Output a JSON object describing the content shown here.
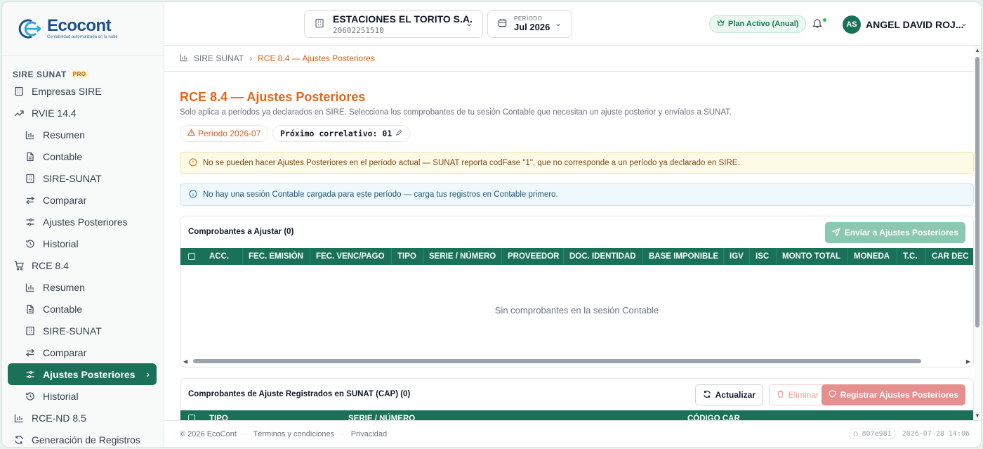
{
  "brand": {
    "name": "Ecocont",
    "tagline": "Contabilidad automatizada en la nube"
  },
  "sidebar": {
    "section_title": "SIRE SUNAT",
    "section_badge": "PRO",
    "items": [
      {
        "label": "Empresas SIRE",
        "icon": "building-icon"
      },
      {
        "label": "RVIE 14.4",
        "icon": "trending-up-icon"
      },
      {
        "label": "Resumen",
        "icon": "bar-chart-icon"
      },
      {
        "label": "Contable",
        "icon": "document-icon"
      },
      {
        "label": "SIRE-SUNAT",
        "icon": "building-icon"
      },
      {
        "label": "Comparar",
        "icon": "arrows-exchange-icon"
      },
      {
        "label": "Ajustes Posteriores",
        "icon": "sliders-icon"
      },
      {
        "label": "Historial",
        "icon": "history-icon"
      },
      {
        "label": "RCE 8.4",
        "icon": "cart-icon"
      },
      {
        "label": "Resumen",
        "icon": "bar-chart-icon"
      },
      {
        "label": "Contable",
        "icon": "document-icon"
      },
      {
        "label": "SIRE-SUNAT",
        "icon": "building-icon"
      },
      {
        "label": "Comparar",
        "icon": "arrows-exchange-icon"
      },
      {
        "label": "Ajustes Posteriores",
        "icon": "sliders-icon"
      },
      {
        "label": "Historial",
        "icon": "history-icon"
      },
      {
        "label": "RCE-ND 8.5",
        "icon": "bar-chart-icon"
      },
      {
        "label": "Generación de Registros",
        "icon": "refresh-icon"
      }
    ]
  },
  "header": {
    "company_name": "ESTACIONES EL TORITO S.A.",
    "company_ruc": "20602251510",
    "period_label": "PERÍODO",
    "period_value": "Jul 2026",
    "plan_badge": "Plan Activo (Anual)",
    "avatar_initials": "AS",
    "user_name": "ANGEL DAVID ROJ..."
  },
  "breadcrumb": {
    "root": "SIRE SUNAT",
    "current": "RCE 8.4 — Ajustes Posteriores"
  },
  "page": {
    "title": "RCE 8.4 — Ajustes Posteriores",
    "subtitle": "Solo aplica a períodos ya declarados en SIRE. Selecciona los comprobantes de tu sesión Contable que necesitan un ajuste posterior y envíalos a SUNAT.",
    "period_chip": "Período 2026-07",
    "correlativo_chip": "Próximo correlativo: 01",
    "warning": "No se pueden hacer Ajustes Posteriores en el período actual — SUNAT reporta codFase \"1\", que no corresponde a un período ya declarado en SIRE.",
    "info": "No hay una sesión Contable cargada para este período — carga tus registros en Contable primero."
  },
  "card1": {
    "title": "Comprobantes a Ajustar (0)",
    "send_button": "Enviar a Ajustes Posteriores",
    "columns": [
      "ACC.",
      "FEC. EMISIÓN",
      "FEC. VENC/PAGO",
      "TIPO",
      "SERIE / NÚMERO",
      "PROVEEDOR",
      "DOC. IDENTIDAD",
      "BASE IMPONIBLE",
      "IGV",
      "ISC",
      "MONTO TOTAL",
      "MONEDA",
      "T.C.",
      "CAR DEC"
    ],
    "empty": "Sin comprobantes en la sesión Contable"
  },
  "card2": {
    "title": "Comprobantes de Ajuste Registrados en SUNAT (CAP) (0)",
    "refresh_button": "Actualizar",
    "delete_button": "Eliminar",
    "register_button": "Registrar Ajustes Posteriores",
    "columns": [
      "TIPO",
      "SERIE / NÚMERO",
      "CÓDIGO CAR"
    ]
  },
  "footer": {
    "copyright": "© 2026 EcoCont",
    "terms": "Términos y condiciones",
    "privacy": "Privacidad",
    "build_hash": "807e981",
    "timestamp": "2026-07-28 14:06"
  },
  "colors": {
    "primary": "#1a7158",
    "accent": "#e2671d",
    "brand": "#1d4f8c"
  }
}
